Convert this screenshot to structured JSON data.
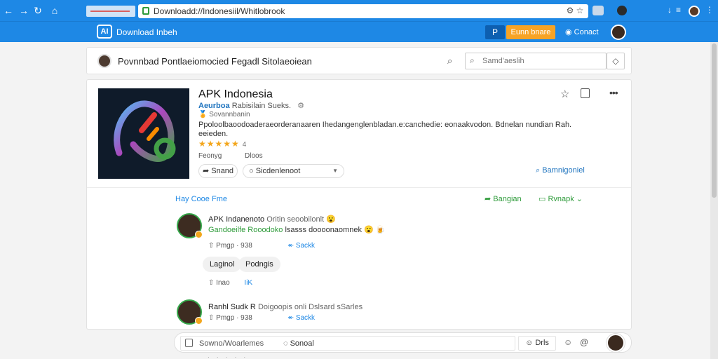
{
  "browser": {
    "url": "Downloadd://Indonesiil/Whitlobrook",
    "nav": {
      "back_icon": "back-arrow-icon",
      "forward_icon": "forward-arrow-icon",
      "reload_icon": "reload-icon"
    }
  },
  "header": {
    "brand": "Download Inbeh",
    "logo_text": "AI",
    "search_icon": "P",
    "cta_label": "Eunn bnare",
    "contact_label": "Conact"
  },
  "page_header": {
    "title": "Povnnbad Pontlaeiomocied Fegadl Sitolaeoiean",
    "search_placeholder": "Samd'aeslih"
  },
  "app": {
    "name": "APK Indonesia",
    "publisher": "Aeurboa",
    "publisher_rest": "Rabisilain Sueks.",
    "meta2_emoji": "🏅",
    "meta2_text": "Sovannbanin",
    "description": "Ppoloolbaoodoaderaeorderanaaren Ihedangenglenbladan.e:canchedie: eonaakvodon. Bdnelan nundian Rah. eeieden.",
    "stars": "★★★★★",
    "rating_count": "4",
    "stat_1": "Feonyg",
    "stat_2": "Dloos",
    "share_pill": "Snand",
    "select_pill": "Sicdenlenoot",
    "search_link": "Bamnigoniel"
  },
  "comments": {
    "section_title": "Hay Cooe Fme",
    "action_share": "Bangian",
    "action_reply": "Rvnapk",
    "items": [
      {
        "name": "APK Indanenoto",
        "name_tail": "Oritin seoobilonlt 😮",
        "text_green": "Gandoeilfe Rooodoko",
        "text_rest": "lsasss doooonaomnek 😮 🍺",
        "meta_count": "Pmgp · 938",
        "meta_reply": "Sackk"
      },
      {
        "name": "Ranhl Sudk R",
        "name_tail": "Doigoopis onli Dslsard sSarles",
        "meta_count": "Pmgp · 938",
        "meta_reply": "Sackk"
      }
    ],
    "tag_1": "Laginol",
    "tag_2": "Podngis",
    "sub_meta": "Inao",
    "sub_link": "IiK"
  },
  "composer": {
    "placeholder": "Sowno/Woarlemes",
    "send_label": "Sonoal",
    "button_label": "Drls"
  },
  "colors": {
    "primary": "#1e88e5",
    "accent": "#f7a325",
    "green": "#2e9b3a"
  }
}
